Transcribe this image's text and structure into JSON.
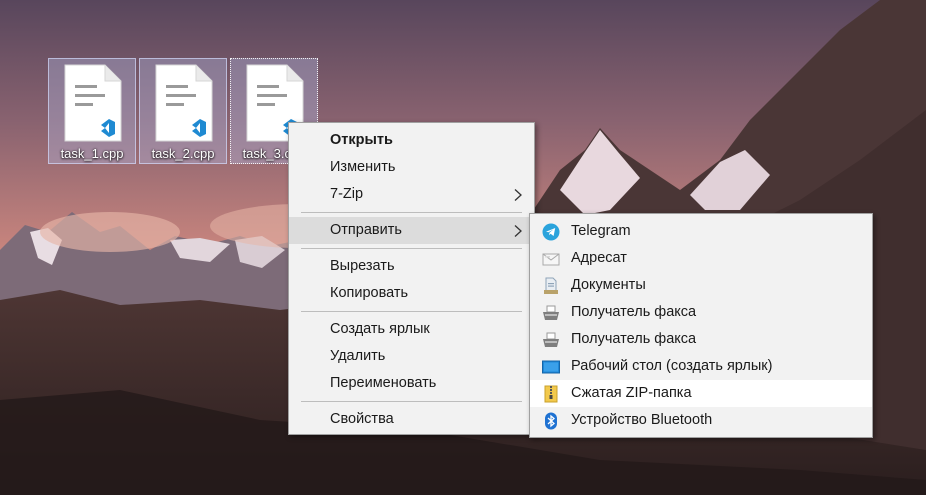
{
  "desktop": {
    "icons": [
      {
        "label": "task_1.cpp"
      },
      {
        "label": "task_2.cpp"
      },
      {
        "label": "task_3.cpp"
      }
    ]
  },
  "context_menu": {
    "items": [
      {
        "label": "Открыть"
      },
      {
        "label": "Изменить"
      },
      {
        "label": "7-Zip"
      },
      {
        "label": "Отправить"
      },
      {
        "label": "Вырезать"
      },
      {
        "label": "Копировать"
      },
      {
        "label": "Создать ярлык"
      },
      {
        "label": "Удалить"
      },
      {
        "label": "Переименовать"
      },
      {
        "label": "Свойства"
      }
    ]
  },
  "sendto_menu": {
    "items": [
      {
        "label": "Telegram",
        "icon": "telegram-icon"
      },
      {
        "label": "Адресат",
        "icon": "mail-recipient-icon"
      },
      {
        "label": "Документы",
        "icon": "documents-icon"
      },
      {
        "label": "Получатель факса",
        "icon": "fax-icon"
      },
      {
        "label": "Получатель факса",
        "icon": "fax-icon"
      },
      {
        "label": "Рабочий стол (создать ярлык)",
        "icon": "desktop-icon"
      },
      {
        "label": "Сжатая ZIP-папка",
        "icon": "zip-folder-icon"
      },
      {
        "label": "Устройство Bluetooth",
        "icon": "bluetooth-icon"
      }
    ]
  },
  "colors": {
    "menu_bg": "#f2f2f2",
    "menu_highlight": "#dcdcdc",
    "submenu_highlight": "#ffffff",
    "vscode_blue": "#1f8ad2",
    "telegram_blue": "#2aa3dc"
  }
}
